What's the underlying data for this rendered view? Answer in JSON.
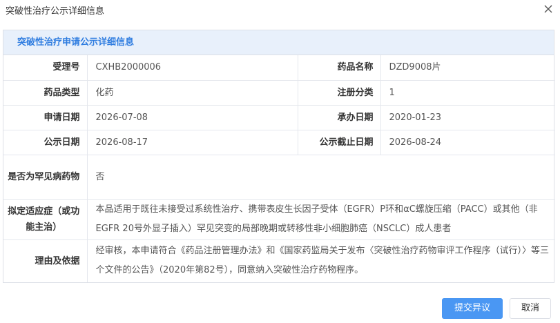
{
  "dialog": {
    "title": "突破性治疗公示详细信息",
    "close_icon": "close-icon"
  },
  "panel": {
    "header": "突破性治疗申请公示详细信息"
  },
  "fields": {
    "acceptance_no_label": "受理号",
    "acceptance_no": "CXHB2000006",
    "drug_name_label": "药品名称",
    "drug_name": "DZD9008片",
    "drug_type_label": "药品类型",
    "drug_type": "化药",
    "reg_class_label": "注册分类",
    "reg_class": "1",
    "apply_date_label": "申请日期",
    "apply_date": "2026-07-08",
    "handle_date_label": "承办日期",
    "handle_date": "2020-01-23",
    "publish_date_label": "公示日期",
    "publish_date": "2026-08-17",
    "publish_end_label": "公示截止日期",
    "publish_end": "2026-08-24",
    "rare_disease_label": "是否为罕见病药物",
    "rare_disease": "否",
    "indication_label": "拟定适应症（或功能主治）",
    "indication": "本品适用于既往未接受过系统性治疗、携带表皮生长因子受体（EGFR）P环和αC螺旋压缩（PACC）或其他（非EGFR 20号外显子插入）罕见突变的局部晚期或转移性非小细胞肺癌（NSCLC）成人患者",
    "reason_label": "理由及依据",
    "reason": "经审核，本申请符合《药品注册管理办法》和《国家药监局关于发布〈突破性治疗药物审评工作程序（试行）〉等三个文件的公告》（2020年第82号），同意纳入突破性治疗药物程序。"
  },
  "buttons": {
    "submit": "提交异议",
    "cancel": "取消"
  },
  "colors": {
    "accent": "#2e7ce0",
    "primary_button": "#4a97f3",
    "header_bg": "#e8f0fb"
  }
}
